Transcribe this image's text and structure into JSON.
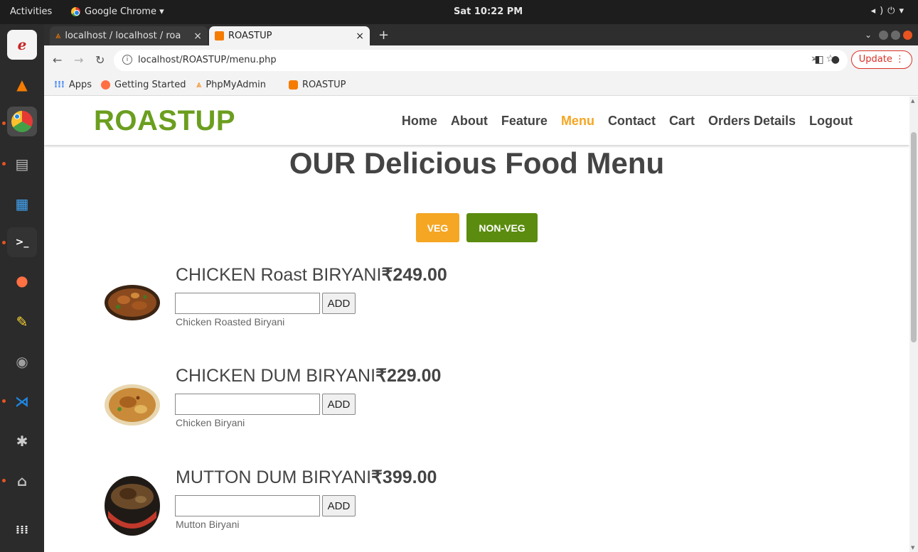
{
  "desktop": {
    "activities_label": "Activities",
    "app_name": "Google Chrome ▾",
    "clock": "Sat 10:22 PM"
  },
  "browser": {
    "tabs": [
      {
        "title": "localhost / localhost / roa",
        "active": false
      },
      {
        "title": "ROASTUP",
        "active": true
      }
    ],
    "url": "localhost/ROASTUP/menu.php",
    "update_label": "Update",
    "bookmarks": [
      {
        "label": "Apps"
      },
      {
        "label": "Getting Started"
      },
      {
        "label": "PhpMyAdmin"
      },
      {
        "label": "ROASTUP"
      }
    ]
  },
  "site": {
    "brand": "ROASTUP",
    "brand_color": "#6b9e1f",
    "accent_color": "#f5a623",
    "nav": [
      {
        "label": "Home",
        "active": false
      },
      {
        "label": "About",
        "active": false
      },
      {
        "label": "Feature",
        "active": false
      },
      {
        "label": "Menu",
        "active": true
      },
      {
        "label": "Contact",
        "active": false
      },
      {
        "label": "Cart",
        "active": false
      },
      {
        "label": "Orders Details",
        "active": false
      },
      {
        "label": "Logout",
        "active": false
      }
    ],
    "page_title": "OUR Delicious Food Menu",
    "filters": {
      "veg_label": "VEG",
      "nonveg_label": "NON-VEG"
    },
    "add_label": "ADD",
    "menu": [
      {
        "name": "CHICKEN Roast BIRYANI",
        "price": "₹249.00",
        "description": "Chicken Roasted Biryani",
        "quantity": ""
      },
      {
        "name": "CHICKEN DUM BIRYANI",
        "price": "₹229.00",
        "description": "Chicken Biryani",
        "quantity": ""
      },
      {
        "name": "MUTTON DUM BIRYANI",
        "price": "₹399.00",
        "description": "Mutton Biryani",
        "quantity": ""
      }
    ]
  }
}
